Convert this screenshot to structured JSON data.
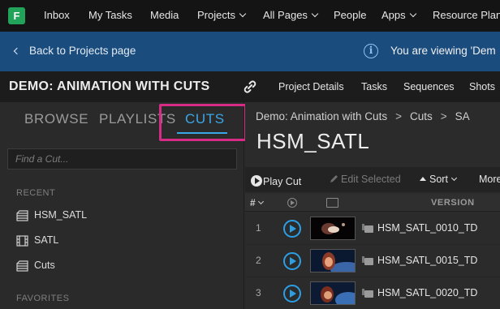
{
  "topnav": {
    "logo": "F",
    "items": [
      {
        "label": "Inbox"
      },
      {
        "label": "My Tasks"
      },
      {
        "label": "Media"
      },
      {
        "label": "Projects"
      },
      {
        "label": "All Pages"
      },
      {
        "label": "People"
      },
      {
        "label": "Apps"
      },
      {
        "label": "Resource Plann"
      }
    ]
  },
  "banner": {
    "back_label": "Back to Projects page",
    "message": "You are viewing 'Dem"
  },
  "project": {
    "title": "DEMO: ANIMATION WITH CUTS",
    "tabs": [
      {
        "label": "Project Details"
      },
      {
        "label": "Tasks"
      },
      {
        "label": "Sequences"
      },
      {
        "label": "Shots"
      }
    ]
  },
  "sidebar": {
    "tabs": {
      "browse": "BROWSE",
      "playlists": "PLAYLISTS",
      "cuts": "CUTS"
    },
    "active_tab": "CUTS",
    "accent_color": "#3aa7e6",
    "highlight_color": "#d62c86",
    "search_placeholder": "Find a Cut...",
    "recent_label": "RECENT",
    "recent_items": [
      {
        "label": "HSM_SATL",
        "icon": "cut-icon"
      },
      {
        "label": "SATL",
        "icon": "sequence-icon"
      },
      {
        "label": "Cuts",
        "icon": "cut-icon"
      }
    ],
    "favorites_label": "FAVORITES"
  },
  "main": {
    "breadcrumb": {
      "project": "Demo: Animation with Cuts",
      "section": "Cuts",
      "current": "SA"
    },
    "title": "HSM_SATL",
    "toolbar": {
      "play_cut": "Play Cut",
      "edit_selected": "Edit Selected",
      "sort": "Sort",
      "more": "More"
    },
    "columns": {
      "num": "#",
      "version": "VERSION"
    },
    "rows": [
      {
        "num": "1",
        "version": "HSM_SATL_0010_TD"
      },
      {
        "num": "2",
        "version": "HSM_SATL_0015_TD"
      },
      {
        "num": "3",
        "version": "HSM_SATL_0020_TD"
      }
    ]
  }
}
